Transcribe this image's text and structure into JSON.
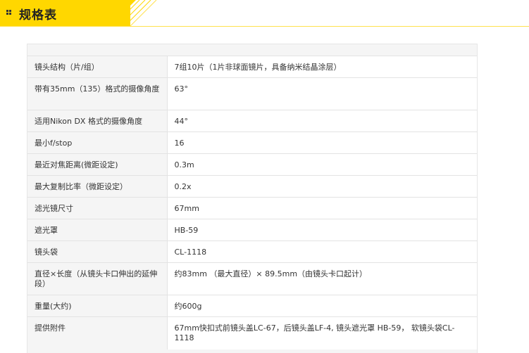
{
  "header": {
    "title": "规格表"
  },
  "colors": {
    "accent": "#ffd700",
    "row_label_bg": "#f5f5f5",
    "row_value_bg": "#ffffff",
    "border": "#e3e3e3"
  },
  "specs": [
    {
      "label": "镜头结构（片/组）",
      "value": "7组10片（1片非球面镜片，具备纳米结晶涂层）"
    },
    {
      "label": "带有35mm（135）格式的摄像角度",
      "value": "63°"
    },
    {
      "label": "适用Nikon DX 格式的摄像角度",
      "value": "44°"
    },
    {
      "label": "最小f/stop",
      "value": "16"
    },
    {
      "label": "最近对焦距离(微距设定)",
      "value": "0.3m"
    },
    {
      "label": "最大复制比率（微距设定）",
      "value": "0.2x"
    },
    {
      "label": "滤光镜尺寸",
      "value": "67mm"
    },
    {
      "label": "遮光罩",
      "value": "HB-59"
    },
    {
      "label": "镜头袋",
      "value": "CL-1118"
    },
    {
      "label": "直径×长度（从镜头卡口伸出的延伸段）",
      "value": "约83mm （最大直径）× 89.5mm（由镜头卡口起计）"
    },
    {
      "label": "重量(大约)",
      "value": "约600g"
    },
    {
      "label": "提供附件",
      "value": "67mm快扣式前镜头盖LC-67，后镜头盖LF-4, 镜头遮光罩 HB-59， 软镜头袋CL-1118"
    }
  ]
}
